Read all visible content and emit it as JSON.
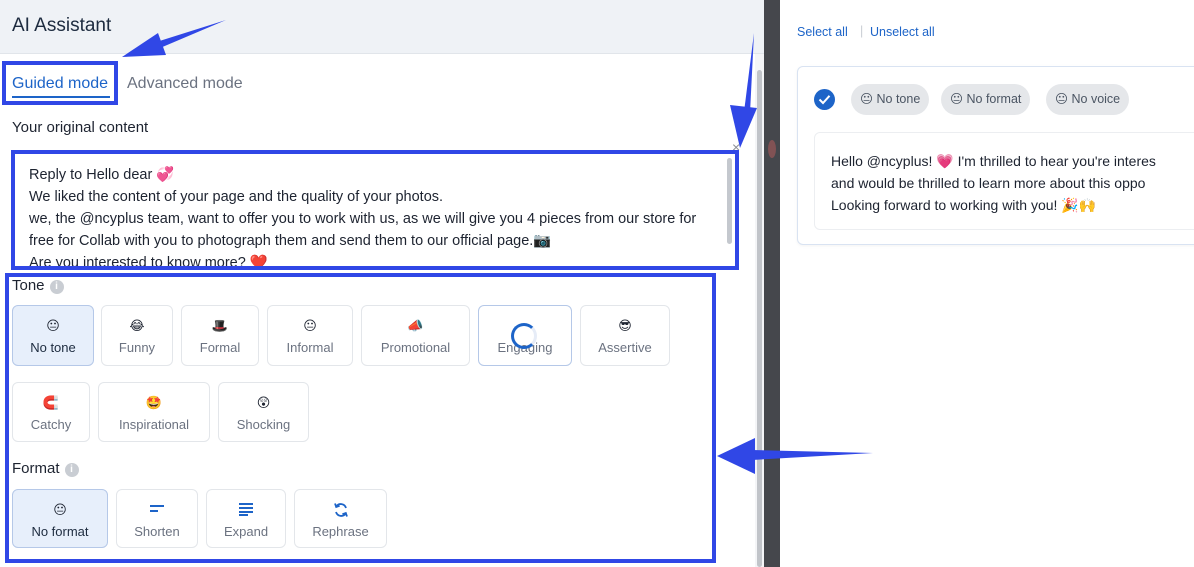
{
  "left": {
    "title": "AI Assistant",
    "tabs": [
      {
        "label": "Guided mode",
        "active": true
      },
      {
        "label": "Advanced mode",
        "active": false
      }
    ],
    "original_label": "Your original content",
    "original_text": "Reply to Hello dear 💞\nWe liked the content of your page and the quality of your photos.\nwe, the @ncyplus team, want to offer you to work with us, as we will give you 4 pieces from our store for free for Collab with you to photograph them and send them to our official page.📷\nAre you interested to know more?  ❤️",
    "close_glyph": "×",
    "tone": {
      "label": "Tone",
      "info": "i",
      "options": [
        {
          "emoji": "😐",
          "label": "No tone",
          "selected": true
        },
        {
          "emoji": "😂",
          "label": "Funny",
          "selected": false
        },
        {
          "emoji": "🎩",
          "label": "Formal",
          "selected": false
        },
        {
          "emoji": "😐",
          "label": "Informal",
          "selected": false
        },
        {
          "emoji": "📣",
          "label": "Promotional",
          "selected": false
        },
        {
          "emoji": "",
          "label": "Engaging",
          "selected": false,
          "loading": true
        },
        {
          "emoji": "😎",
          "label": "Assertive",
          "selected": false
        },
        {
          "emoji": "🧲",
          "label": "Catchy",
          "selected": false
        },
        {
          "emoji": "🤩",
          "label": "Inspirational",
          "selected": false
        },
        {
          "emoji": "😲",
          "label": "Shocking",
          "selected": false
        }
      ]
    },
    "format": {
      "label": "Format",
      "info": "i",
      "options": [
        {
          "icon": "neutral-face",
          "emoji": "😐",
          "label": "No format",
          "selected": true
        },
        {
          "icon": "shorten-lines-icon",
          "label": "Shorten",
          "selected": false
        },
        {
          "icon": "expand-lines-icon",
          "label": "Expand",
          "selected": false
        },
        {
          "icon": "rephrase-arrows-icon",
          "label": "Rephrase",
          "selected": false
        }
      ]
    }
  },
  "right": {
    "select_all": "Select all",
    "separator": "|",
    "unselect_all": "Unselect all",
    "result": {
      "checked": true,
      "chips": [
        "😐 No tone",
        "😐 No format",
        "😐 No voice"
      ],
      "text": "Hello @ncyplus! 💗 I'm thrilled to hear you're interes\nand would be thrilled to learn more about this oppo\nLooking forward to working with you! 🎉🙌"
    }
  },
  "colors": {
    "accent": "#1d64c8",
    "annotation": "#3047e6",
    "selected_bg": "#e7effb",
    "divider": "#45474c"
  }
}
